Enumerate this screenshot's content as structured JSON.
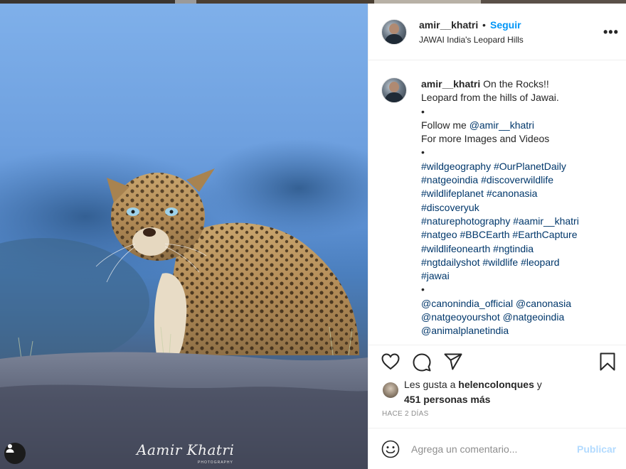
{
  "post": {
    "username": "amir__khatri",
    "follow_separator": "•",
    "follow_label": "Seguir",
    "location": "JAWAI India's Leopard Hills",
    "more_icon": "more-horizontal-icon"
  },
  "photo": {
    "subject": "leopard",
    "watermark": "Aamir Khatri",
    "watermark_sub": "PHOTOGRAPHY"
  },
  "caption": {
    "username": "amir__khatri",
    "lines": [
      {
        "text": " On the Rocks!!"
      },
      {
        "text": "Leopard from the hills of Jawai."
      },
      {
        "text": "•"
      },
      {
        "prefix": "Follow me ",
        "link": "@amir__khatri"
      },
      {
        "text": "For more Images and Videos"
      },
      {
        "text": "•"
      },
      {
        "link": "#wildgeography #OurPlanetDaily"
      },
      {
        "link": "#natgeoindia #discoverwildlife"
      },
      {
        "link": "#wildlifeplanet #canonasia"
      },
      {
        "link": "#discoveryuk"
      },
      {
        "link": "#naturephotography #aamir__khatri"
      },
      {
        "link": "#natgeo #BBCEarth #EarthCapture"
      },
      {
        "link": "#wildlifeonearth #ngtindia"
      },
      {
        "link": "#ngtdailyshot #wildlife #leopard"
      },
      {
        "link": "#jawai"
      },
      {
        "text": "•"
      },
      {
        "link": "@canonindia_official @canonasia"
      },
      {
        "link": "@natgeoyourshot @natgeoindia"
      },
      {
        "link": "@animalplanetindia"
      }
    ]
  },
  "actions": {
    "like_icon": "heart-icon",
    "comment_icon": "comment-icon",
    "share_icon": "send-icon",
    "save_icon": "bookmark-icon"
  },
  "likes": {
    "prefix": "Les gusta a ",
    "user": "helencolonques",
    "conjunction": " y",
    "others": "451 personas más"
  },
  "timestamp": "HACE 2 DÍAS",
  "comment": {
    "placeholder": "Agrega un comentario...",
    "submit_label": "Publicar"
  },
  "colors": {
    "link_blue": "#0095f6",
    "hashtag_blue": "#00376b",
    "publish_disabled": "#b3dbff",
    "text": "#262626",
    "muted": "#8e8e8e"
  }
}
